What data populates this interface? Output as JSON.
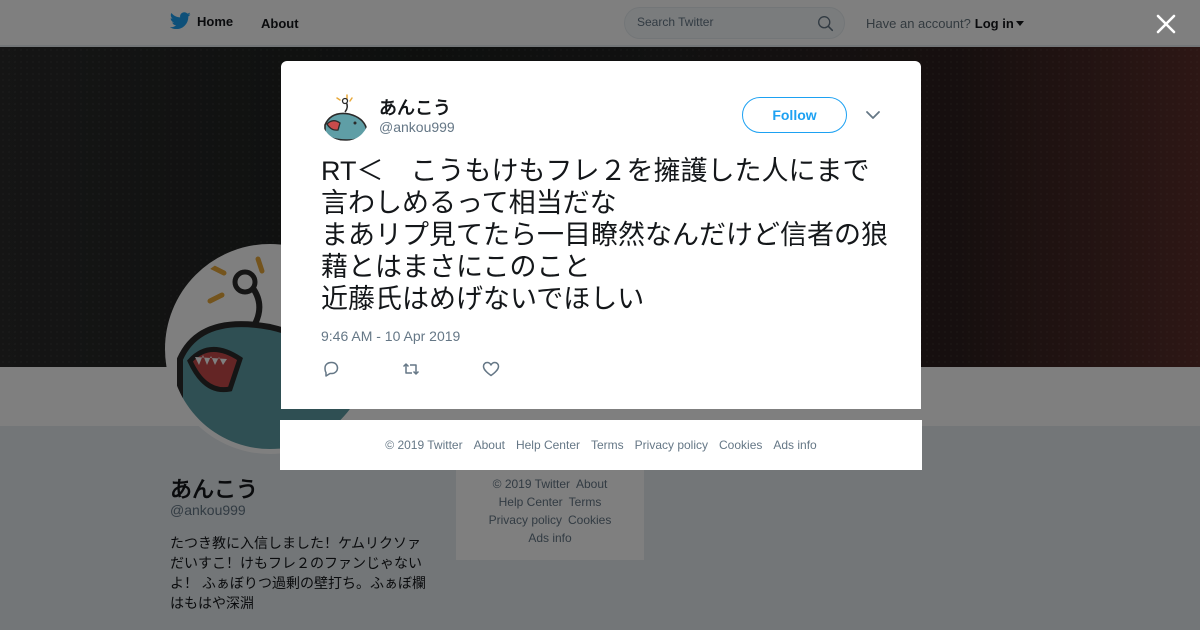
{
  "topbar": {
    "home_label": "Home",
    "about_label": "About",
    "search_placeholder": "Search Twitter",
    "account_prompt": "Have an account?",
    "login_label": "Log in"
  },
  "profile": {
    "name": "あんこう",
    "handle": "@ankou999",
    "bio": "たつき教に入信しました！ケムリクソァだいすこ！けもフレ２のファンじゃないよ！ ふぁぼりつ過剰の壁打ち。ふぁぼ欄はもはや深淵"
  },
  "side_footer": {
    "copyright": "© 2019 Twitter",
    "about": "About",
    "help_center": "Help Center",
    "terms": "Terms",
    "privacy": "Privacy policy",
    "cookies": "Cookies",
    "ads_info": "Ads info"
  },
  "tweet": {
    "author_name": "あんこう",
    "author_handle": "@ankou999",
    "follow_label": "Follow",
    "text": "RT＜　こうもけもフレ２を擁護した人にまで言わしめるって相当だな\nまあリプ見てたら一目瞭然なんだけど信者の狼藉とはまさにこのこと\n近藤氏はめげないでほしい",
    "timestamp": "9:46 AM - 10 Apr 2019"
  },
  "modal_footer": {
    "copyright": "© 2019 Twitter",
    "about": "About",
    "help_center": "Help Center",
    "terms": "Terms",
    "privacy": "Privacy policy",
    "cookies": "Cookies",
    "ads_info": "Ads info"
  },
  "icons": {
    "logo": "twitter-bird-icon",
    "search": "search-icon",
    "close": "close-icon",
    "menu": "chevron-down-icon",
    "reply": "reply-icon",
    "retweet": "retweet-icon",
    "like": "heart-icon"
  },
  "colors": {
    "brand": "#1da1f2",
    "text": "#14171a",
    "secondary_text": "#657786",
    "background": "#e6ecf0"
  }
}
